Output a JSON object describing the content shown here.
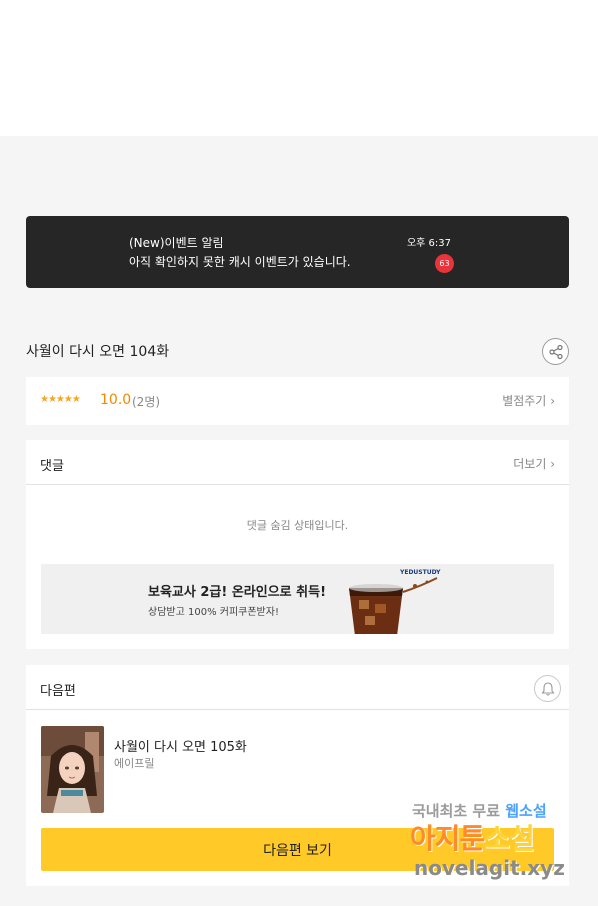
{
  "notification": {
    "title": "(New)이벤트 알림",
    "message": "아직 확인하지 못한 캐시 이벤트가 있습니다.",
    "time": "오후 6:37",
    "badge": "63",
    "badge_color": "#e8343a"
  },
  "episode": {
    "title": "사월이 다시 오면 104화",
    "share_icon": "share-icon"
  },
  "rating": {
    "stars": "★★★★★",
    "score": "10.0",
    "count": "(2명)",
    "rate_link": "별점주기",
    "accent_color": "#f08a00"
  },
  "comments": {
    "title": "댓글",
    "more_link": "더보기",
    "hidden_message": "댓글 숨김 상태입니다."
  },
  "ad": {
    "headline": "보육교사 2급! 온라인으로 취득!",
    "subtext": "상담받고 100% 커피쿠폰받자!",
    "brand": "YEDUSTUDY"
  },
  "next_episode": {
    "section_title": "다음편",
    "title": "사월이 다시 오면 105화",
    "author": "에이프릴",
    "button_label": "다음편 보기",
    "button_color": "#ffc928",
    "bell_icon": "bell-icon"
  },
  "watermark": {
    "line1_prefix": "국내최초 무료 ",
    "line1_highlight": "웹소설",
    "line2_prefix": "아지툰",
    "line2_highlight": "소설",
    "line3": "novelagit.xyz"
  }
}
